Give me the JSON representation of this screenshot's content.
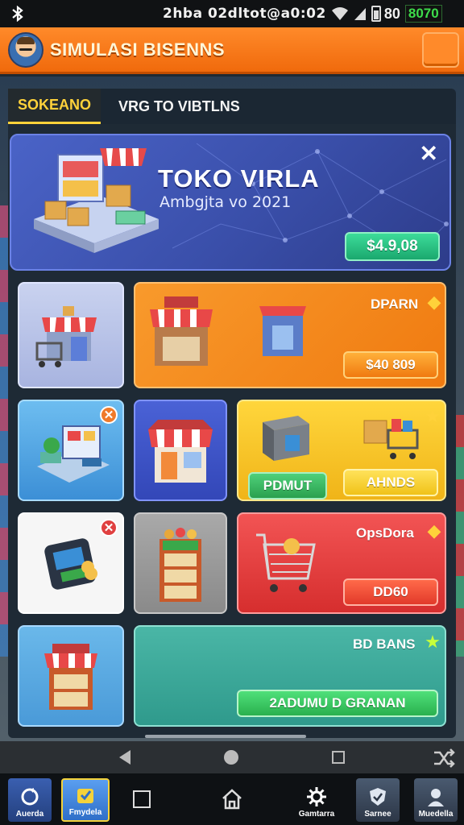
{
  "status_bar": {
    "text": "2hba 02dltot@a0:02",
    "battery_pct": "80",
    "network": "8070"
  },
  "header": {
    "title": "SIMULASI BISENNS"
  },
  "tabs": [
    {
      "label": "SOKEANO",
      "active": true
    },
    {
      "label": "VRG TO VIBTLNS",
      "active": false
    }
  ],
  "banner": {
    "title": "TOKO VIRLA",
    "subtitle": "Ambgjta vo 2021",
    "price": "$4.9,08",
    "close": "✕"
  },
  "cards": {
    "orange": {
      "label": "DPARN",
      "button": "$40 809"
    },
    "yellow": {
      "left_button": "PDMUT",
      "right_button": "AHNDS"
    },
    "red": {
      "label": "OpsDora",
      "button": "DD60"
    },
    "teal": {
      "label": "BD BANS",
      "button": "2ADUMU D GRANAN"
    }
  },
  "bottom_bar": {
    "items": [
      {
        "label": "Auerda",
        "icon": "refresh-icon"
      },
      {
        "label": "Fmydela",
        "icon": "check-badge-icon"
      },
      {
        "label": "",
        "icon": "square-icon"
      },
      {
        "label": "",
        "icon": "home-icon"
      },
      {
        "label": "Gamtarra",
        "icon": "gear-icon"
      },
      {
        "label": "Sarnee",
        "icon": "shield-icon"
      },
      {
        "label": "Muedella",
        "icon": "user-icon"
      }
    ]
  },
  "colors": {
    "header": "#f27514",
    "banner": "#4a63c7",
    "orange_card": "#f28a1e",
    "yellow_card": "#f4c52a",
    "red_card": "#e03a3a",
    "teal_card": "#3aa89a",
    "accent_green": "#2fc76a"
  }
}
